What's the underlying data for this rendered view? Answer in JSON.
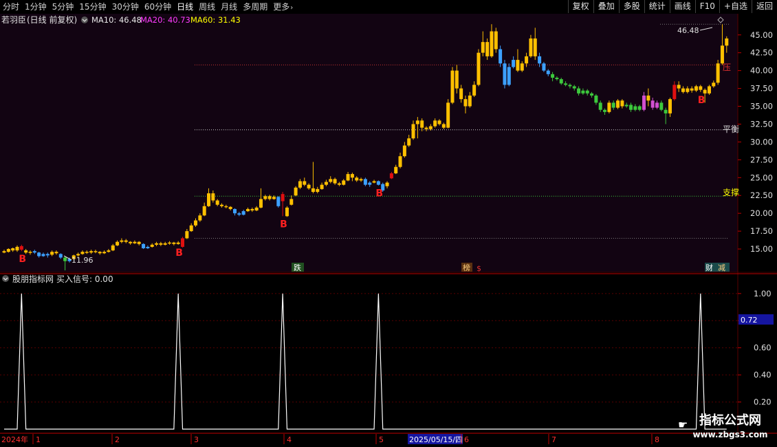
{
  "toolbar": {
    "tabs": [
      {
        "label": "分时",
        "active": false
      },
      {
        "label": "1分钟",
        "active": false
      },
      {
        "label": "5分钟",
        "active": false
      },
      {
        "label": "15分钟",
        "active": false
      },
      {
        "label": "30分钟",
        "active": false
      },
      {
        "label": "60分钟",
        "active": false
      },
      {
        "label": "日线",
        "active": true
      },
      {
        "label": "周线",
        "active": false
      },
      {
        "label": "月线",
        "active": false
      },
      {
        "label": "多周期",
        "active": false
      },
      {
        "label": "更多",
        "active": false
      }
    ],
    "more_chevron": "›",
    "right_buttons": [
      "复权",
      "叠加",
      "多股",
      "统计",
      "画线",
      "F10",
      "+自选",
      "返回"
    ]
  },
  "main": {
    "stock_name": "若羽臣",
    "period_label": "(日线 前复权)",
    "ma": [
      {
        "label": "MA10: 46.48",
        "color": "#e8e8e8"
      },
      {
        "label": "MA20: 40.73",
        "color": "#ff3cff"
      },
      {
        "label": "MA60: 31.43",
        "color": "#ffff00"
      }
    ],
    "price_axis": [
      "45.00",
      "42.50",
      "40.00",
      "37.50",
      "35.00",
      "32.50",
      "30.00",
      "27.50",
      "25.00",
      "22.50",
      "20.00",
      "17.50",
      "15.00"
    ],
    "high_label": "46.48",
    "low_label": "11.96",
    "zone_labels": {
      "resist": "压",
      "balance": "平衡",
      "support": "支撑"
    },
    "buy_label": "B",
    "event_tags": [
      "跌",
      "榜",
      "$",
      "财",
      "减"
    ]
  },
  "sub": {
    "title": "股朋指标网",
    "signal_label": "买入信号: 0.00",
    "axis": [
      "1.00",
      "0.80",
      "0.60",
      "0.40",
      "0.20"
    ],
    "current_value": "0.72"
  },
  "time_axis": {
    "labels": [
      "2024年",
      "1",
      "2",
      "3",
      "4",
      "5",
      "2025/05/15/四",
      "6",
      "7",
      "8"
    ]
  },
  "watermark": {
    "line1": "指标公式网",
    "line2": "www.zbgs3.com"
  },
  "chart_data": {
    "type": "candlestick",
    "ylim": [
      12.5,
      47.0
    ],
    "candles_text": "14.5 14.7 14.4 14.9 1|14.6 15.0 14.5 15.1 1|15.1 14.8 14.6 15.2 1|14.8 15.3 14.6 15.5 1|15.4 14.9 14.7 15.6 2|14.8 14.5 14.3 15.0 1|14.5 14.6 14.2 14.8 1|14.7 14.5 14.3 14.9 0|14.5 14.0 13.8 14.6 0|14.0 14.3 13.9 14.5 0|14.3 14.1 13.8 14.5 0|14.2 14.6 14.0 14.8 1|14.6 14.4 14.2 14.8 1|14.3 13.8 13.6 14.4 0|13.8 13.3 12.0 13.9 3|13.3 13.6 13.1 13.8 0|13.6 14.1 13.5 14.2 1|14.1 14.3 13.9 14.5 1|14.3 14.6 14.2 14.8 1|14.6 14.5 14.3 14.8 1|14.5 14.7 14.3 14.9 1|14.7 14.6 14.4 14.9 1|14.6 14.4 14.2 14.7 1|14.4 14.6 14.3 14.8 1|14.6 14.8 14.5 15.0 1|14.8 15.5 14.7 15.7 1|15.5 16.0 15.4 16.2 1|16.0 16.2 15.8 16.5 1|16.2 16.0 15.8 16.4 1|16.0 15.8 15.6 16.1 1|15.8 16.0 15.7 16.2 1|16.0 15.7 15.5 16.1 1|15.7 15.1 15.0 15.8 0|15.1 15.3 15.0 15.5 0|15.3 15.6 15.2 15.8 1|15.6 15.8 15.4 16.0 1|15.8 15.6 15.4 16.0 1|15.6 15.8 15.5 16.0 1|15.8 15.9 15.6 16.1 1|15.9 15.7 15.5 16.0 1|15.7 15.9 15.6 16.1 1|15.3 16.5 15.2 16.7 2|16.5 17.5 16.4 17.8 1|17.5 18.3 17.4 18.6 1|18.3 19.0 18.1 19.3 1|19.0 19.7 18.8 20.0 1|19.7 21.0 19.6 21.5 1|21.0 22.8 20.9 23.5 1|22.8 21.8 21.5 23.2 1|21.8 21.2 21.0 22.0 1|21.2 21.0 20.8 21.4 1|21.0 20.9 20.7 21.2 1|20.9 20.6 20.4 21.0 1|20.6 20.0 19.7 20.7 0|20.0 19.8 19.6 20.2 0|19.8 20.3 19.7 20.5 0|20.3 20.6 20.2 20.8 1|20.6 20.4 20.2 20.8 1|20.4 20.8 20.3 21.0 1|20.8 22.0 20.7 23.5 1|22.0 22.4 21.8 22.6 1|22.4 22.0 21.8 22.6 1|22.0 22.3 21.9 22.5 1|22.3 21.0 20.8 22.4 0|21.7 22.7 19.6 23.0 2|19.6 20.8 19.5 21.0 1|21.2 22.0 21.1 22.5 1|22.5 23.6 22.4 23.8 1|23.6 24.5 23.4 24.8 1|24.5 24.0 23.8 25.0 1|24.0 23.5 23.3 24.2 1|23.5 23.0 22.8 27.2 1|23.0 23.4 22.8 23.7 1|23.4 24.0 23.3 24.3 1|24.0 24.4 23.8 24.7 1|24.4 24.8 24.2 25.2 1|24.8 24.2 24.0 25.0 1|24.2 24.0 23.8 24.4 1|24.0 24.6 23.9 24.8 1|24.6 25.5 24.5 25.8 1|25.5 25.0 24.5 25.7 1|25.0 24.6 24.4 25.2 1|24.6 24.8 24.4 25.0 1|24.8 24.0 23.8 25.0 0|24.0 24.3 23.7 24.5 0|24.3 24.5 24.2 24.7 1|24.5 24.0 23.9 24.6 0|23.2 24.1 23.0 24.3 0|23.8 24.3 23.5 24.5 1|24.9 25.6 24.8 25.8 2|25.6 26.5 25.5 26.8 1|26.5 28.0 26.3 28.5 1|28.0 29.5 27.8 30.0 1|29.5 30.5 29.3 31.0 1|30.5 32.5 30.3 33.0 1|32.5 33.0 30.5 33.5 1|33.0 32.0 31.5 33.3 1|32.0 31.8 31.5 32.2 1|31.8 32.2 31.6 32.5 1|32.2 33.0 32.0 33.3 1|33.0 32.5 32.3 33.2 1|32.5 32.0 31.8 32.7 1|32.0 35.5 31.9 36.0 1|35.5 40.0 35.3 40.5 1|40.0 37.5 36.8 40.8 1|37.5 36.0 35.5 38.0 1|36.0 35.0 34.0 36.5 1|35.0 36.5 34.8 37.0 1|36.5 38.0 36.3 38.5 1|38.0 42.5 37.8 43.0 1|42.5 44.0 42.0 45.5 1|44.0 42.0 41.5 44.5 1|42.0 45.5 41.8 46.5 1|45.5 43.0 42.5 46.0 1|43.0 41.0 40.5 43.5 0|41.0 38.0 37.5 41.5 0|38.0 40.5 37.8 41.0 0|40.5 41.5 40.3 42.0 0|41.5 40.0 39.8 43.0 1|40.0 41.0 39.8 41.3 1|41.0 42.0 40.5 42.5 1|42.0 44.5 41.8 45.0 1|44.5 42.0 41.5 46.0 1|42.0 41.0 40.5 42.5 0|41.0 40.0 39.8 41.2 0|40.0 39.5 39.2 40.2 0|39.5 39.0 38.5 39.8 3|39.0 38.8 38.6 39.2 3|38.8 38.2 38.0 39.0 3|38.2 38.0 37.8 38.5 3|38.0 37.8 37.5 38.2 3|37.8 37.5 37.2 38.0 3|37.5 36.8 36.5 37.8 3|36.8 37.2 36.6 37.5 3|37.2 36.8 36.5 37.4 3|36.8 36.5 36.2 37.0 3|36.5 35.5 35.2 36.7 3|35.5 34.5 34.2 35.8 3|34.5 34.2 33.8 34.7 3|34.2 35.5 34.0 35.8 1|35.5 34.8 34.5 35.8 3|34.8 35.8 34.6 36.0 1|35.8 35.0 34.7 36.0 1|35.0 35.2 34.8 35.5 3|35.2 34.5 34.2 35.5 3|34.5 35.0 34.3 35.3 3|35.0 34.5 34.3 35.2 3|34.5 36.5 34.3 37.0 4|36.5 35.8 35.0 37.5 1|35.8 34.8 34.5 36.2 4|34.8 35.5 34.6 35.8 4|35.5 34.5 34.3 35.8 3|34.5 34.0 32.5 34.8 3|34.0 36.0 33.5 36.2 1|36.0 38.0 35.8 38.5 2|38.0 37.5 37.0 38.5 1|37.5 37.0 36.8 37.8 1|37.0 37.5 36.8 37.8 1|37.5 37.2 36.9 37.8 1|37.2 37.8 37.0 38.0 1|37.8 37.3 37.0 38.0 1|37.3 36.8 35.5 37.5 1|36.8 37.8 36.6 38.0 1|37.8 38.3 37.6 38.6 1|38.3 41.0 38.0 41.5 1|41.0 43.5 40.8 46.48 1|43.5 44.5 42.5 44.8 1",
    "buy_signal_indices": [
      4,
      40,
      64,
      86,
      160
    ],
    "lines": [
      {
        "name": "resist",
        "value": 40.8,
        "color": "#c83232",
        "style": "dotted"
      },
      {
        "name": "balance",
        "value": 31.7,
        "color": "#d0d0d0",
        "style": "dotted"
      },
      {
        "name": "support",
        "value": 22.4,
        "color": "#3cc83c",
        "style": "dotted"
      },
      {
        "name": "top",
        "value": 46.5,
        "color": "#7a7a7a",
        "style": "dotted"
      },
      {
        "name": "low",
        "value": 16.5,
        "color": "#7a7a7a",
        "style": "dotted"
      }
    ],
    "colors": {
      "up": "#ffc000",
      "down": "#3ca0ff",
      "green": "#3cc83c",
      "red": "#e01010",
      "magenta": "#d050d0"
    },
    "sub_chart": {
      "type": "line",
      "ylim": [
        0,
        1.05
      ],
      "spike_indices": [
        4,
        40,
        64,
        86,
        160
      ],
      "values_default": 0,
      "value_at_spike": 1
    }
  }
}
